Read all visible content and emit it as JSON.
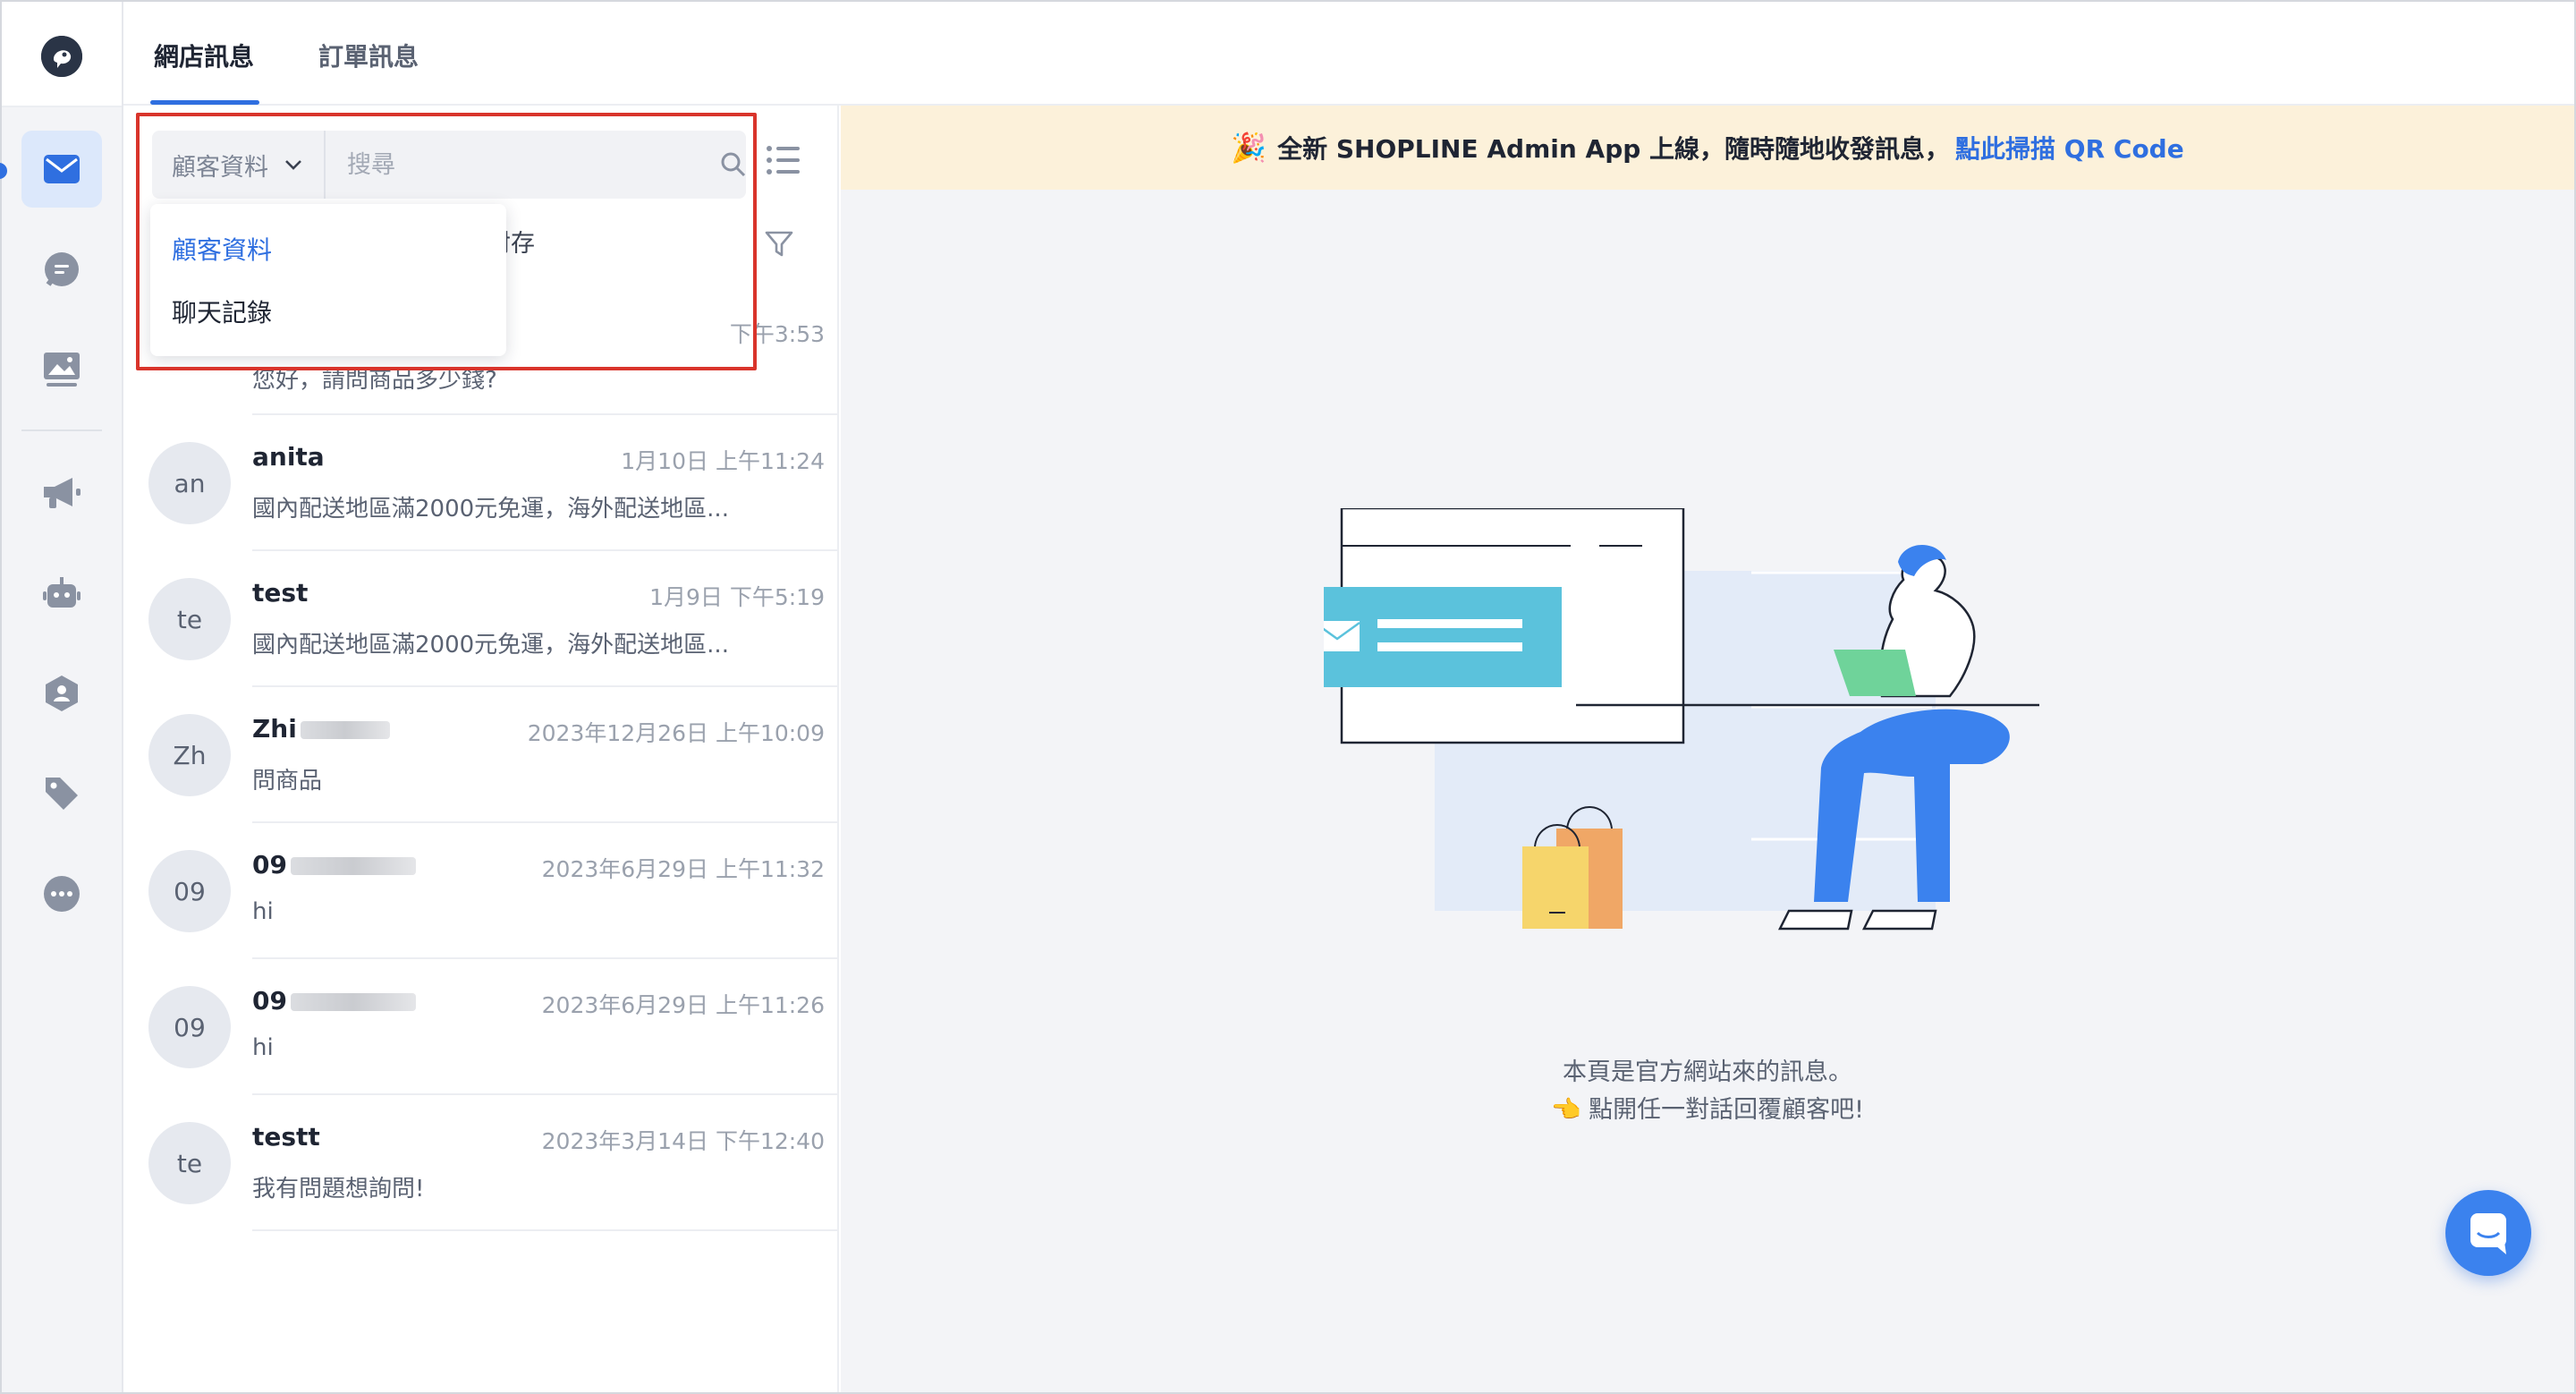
{
  "tabs": {
    "shop_messages": "網店訊息",
    "order_messages": "訂單訊息"
  },
  "search": {
    "type_selected": "顧客資料",
    "placeholder": "搜尋"
  },
  "dropdown": {
    "options": [
      "顧客資料",
      "聊天記錄"
    ]
  },
  "archive_label_visible": "封存",
  "first_conversation": {
    "time": "下午3:53",
    "preview": "您好，請問商品多少錢?"
  },
  "conversations": [
    {
      "initials": "an",
      "name": "anita",
      "time": "1月10日 上午11:24",
      "preview": "國內配送地區滿2000元免運，海外配送地區..."
    },
    {
      "initials": "te",
      "name": "test",
      "time": "1月9日 下午5:19",
      "preview": "國內配送地區滿2000元免運，海外配送地區..."
    },
    {
      "initials": "Zh",
      "name": "Zhi",
      "time": "2023年12月26日 上午10:09",
      "preview": "問商品"
    },
    {
      "initials": "09",
      "name": "09",
      "time": "2023年6月29日 上午11:32",
      "preview": "hi"
    },
    {
      "initials": "09",
      "name": "09",
      "time": "2023年6月29日 上午11:26",
      "preview": "hi"
    },
    {
      "initials": "te",
      "name": "testt",
      "time": "2023年3月14日 下午12:40",
      "preview": "我有問題想詢問!"
    }
  ],
  "banner": {
    "icon": "party-popper-icon",
    "text": "全新 SHOPLINE Admin App 上線，隨時隨地收發訊息，",
    "link": "點此掃描 QR Code"
  },
  "empty_state": {
    "line1": "本頁是官方網站來的訊息。",
    "line2": "👈 點開任一對話回覆顧客吧!"
  },
  "colors": {
    "accent": "#2f6fe0",
    "highlight": "#d9342b",
    "banner_bg": "#fcf1da"
  }
}
